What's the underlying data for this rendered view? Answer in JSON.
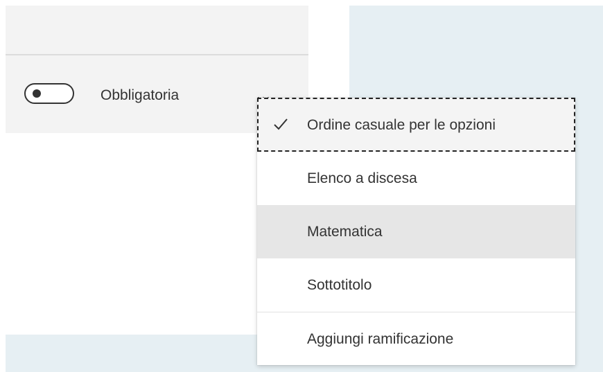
{
  "settings_row": {
    "required_label": "Obbligatoria",
    "required_on": false,
    "more_label": "···"
  },
  "menu": {
    "items": [
      {
        "label": "Ordine casuale per le opzioni",
        "checked": true,
        "icon": "checkmark-icon"
      },
      {
        "label": "Elenco a discesa",
        "checked": false
      },
      {
        "label": "Matematica",
        "checked": false
      },
      {
        "label": "Sottotitolo",
        "checked": false
      },
      {
        "label": "Aggiungi ramificazione",
        "checked": false
      }
    ]
  },
  "colors": {
    "canvas_bg": "#e6eff3",
    "card_bg": "#ffffff",
    "row_bg": "#f3f3f3",
    "menu_hover_bg": "#e6e6e6",
    "text": "#333333"
  }
}
